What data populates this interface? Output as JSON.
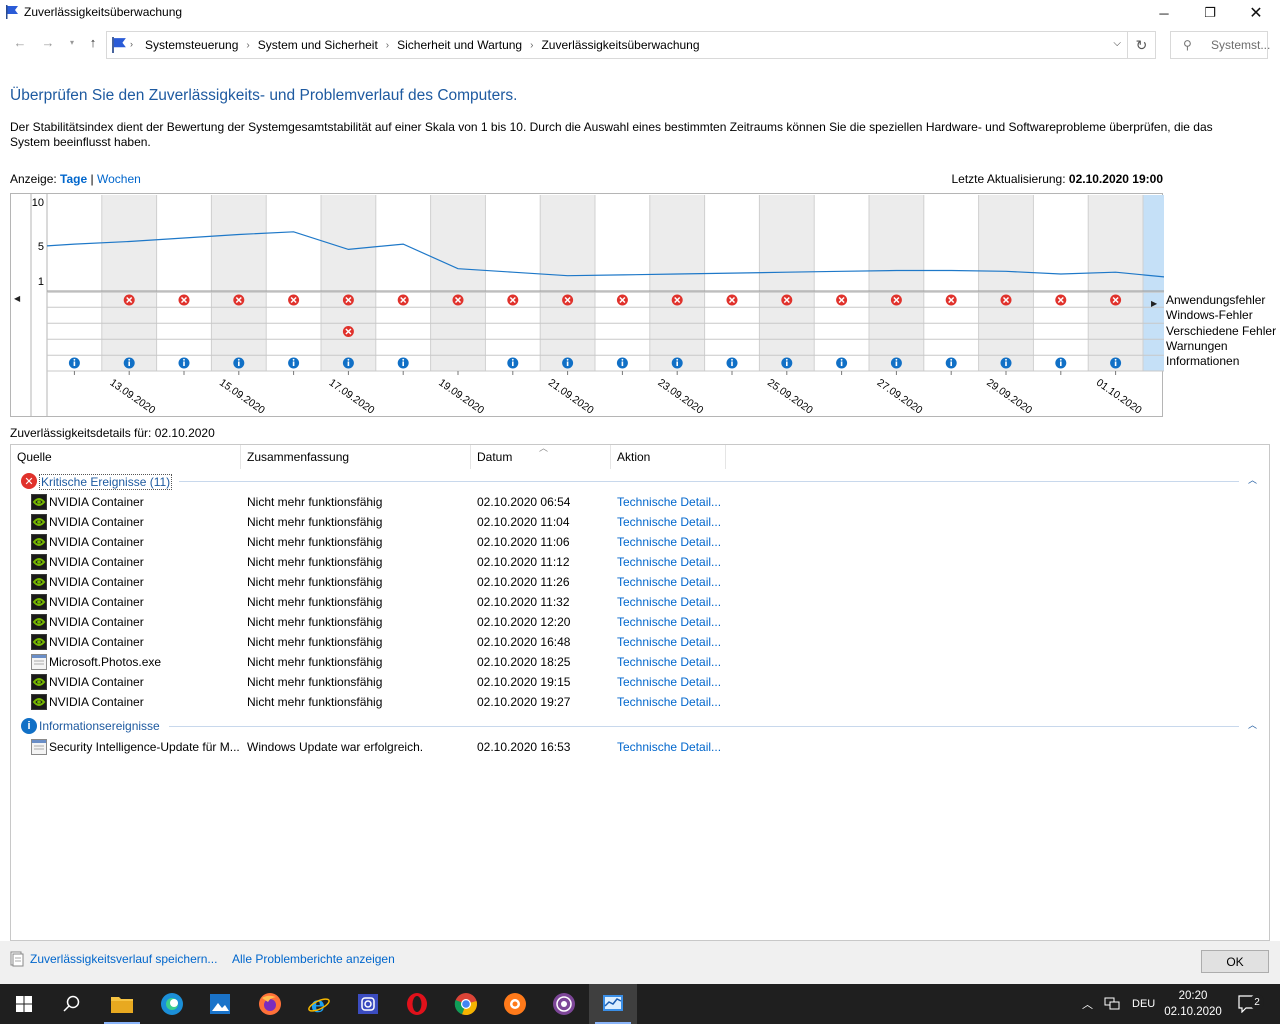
{
  "window": {
    "title": "Zuverlässigkeitsüberwachung"
  },
  "address": {
    "crumbs": [
      "Systemsteuerung",
      "System und Sicherheit",
      "Sicherheit und Wartung",
      "Zuverlässigkeitsüberwachung"
    ],
    "search_placeholder": "Systemst..."
  },
  "heading": "Überprüfen Sie den Zuverlässigkeits- und Problemverlauf des Computers.",
  "description": "Der Stabilitätsindex dient der Bewertung der Systemgesamtstabilität auf einer Skala von 1 bis 10. Durch die Auswahl eines bestimmten Zeitraums können Sie die speziellen Hardware- und Softwareprobleme überprüfen, die das System beeinflusst haben.",
  "view": {
    "label": "Anzeige:",
    "days": "Tage",
    "sep": "|",
    "weeks": "Wochen"
  },
  "last_update": {
    "label": "Letzte Aktualisierung:",
    "value": "02.10.2020 19:00"
  },
  "chart_data": {
    "type": "line",
    "ylim": [
      1,
      10
    ],
    "yticks": [
      "10",
      "5",
      "1"
    ],
    "x": [
      "12.09.2020",
      "13.09.2020",
      "14.09.2020",
      "15.09.2020",
      "16.09.2020",
      "17.09.2020",
      "18.09.2020",
      "19.09.2020",
      "20.09.2020",
      "21.09.2020",
      "22.09.2020",
      "23.09.2020",
      "24.09.2020",
      "25.09.2020",
      "26.09.2020",
      "27.09.2020",
      "28.09.2020",
      "29.09.2020",
      "30.09.2020",
      "01.10.2020",
      "02.10.2020"
    ],
    "xtick_labels": [
      "13.09.2020",
      "15.09.2020",
      "17.09.2020",
      "19.09.2020",
      "21.09.2020",
      "23.09.2020",
      "25.09.2020",
      "27.09.2020",
      "29.09.2020",
      "01.10.2020"
    ],
    "stability_index": [
      5.2,
      5.5,
      5.9,
      6.3,
      6.6,
      4.6,
      5.2,
      2.4,
      2.0,
      1.6,
      1.7,
      1.8,
      1.9,
      2.0,
      2.1,
      2.2,
      2.2,
      2.1,
      1.8,
      2.0,
      1.4
    ],
    "selected_day": "02.10.2020",
    "event_rows": [
      "Anwendungsfehler",
      "Windows-Fehler",
      "Verschiedene Fehler",
      "Warnungen",
      "Informationen"
    ],
    "anwendungsfehler_days": [
      1,
      2,
      3,
      4,
      5,
      6,
      7,
      8,
      9,
      10,
      11,
      12,
      13,
      14,
      15,
      16,
      17,
      18,
      19,
      20
    ],
    "verschiedene_fehler_days": [
      5
    ],
    "informationen_days": [
      0,
      1,
      2,
      3,
      4,
      5,
      6,
      8,
      9,
      10,
      11,
      12,
      13,
      14,
      15,
      16,
      17,
      18,
      19,
      20
    ]
  },
  "details_label": "Zuverlässigkeitsdetails für: 02.10.2020",
  "columns": [
    "Quelle",
    "Zusammenfassung",
    "Datum",
    "Aktion"
  ],
  "groups": [
    {
      "label": "Kritische Ereignisse (11)",
      "rows": [
        {
          "source": "NVIDIA Container",
          "summary": "Nicht mehr funktionsfähig",
          "date": "02.10.2020 06:54",
          "action": "Technische Detail...",
          "icon": "nvidia-icon"
        },
        {
          "source": "NVIDIA Container",
          "summary": "Nicht mehr funktionsfähig",
          "date": "02.10.2020 11:04",
          "action": "Technische Detail...",
          "icon": "nvidia-icon"
        },
        {
          "source": "NVIDIA Container",
          "summary": "Nicht mehr funktionsfähig",
          "date": "02.10.2020 11:06",
          "action": "Technische Detail...",
          "icon": "nvidia-icon"
        },
        {
          "source": "NVIDIA Container",
          "summary": "Nicht mehr funktionsfähig",
          "date": "02.10.2020 11:12",
          "action": "Technische Detail...",
          "icon": "nvidia-icon"
        },
        {
          "source": "NVIDIA Container",
          "summary": "Nicht mehr funktionsfähig",
          "date": "02.10.2020 11:26",
          "action": "Technische Detail...",
          "icon": "nvidia-icon"
        },
        {
          "source": "NVIDIA Container",
          "summary": "Nicht mehr funktionsfähig",
          "date": "02.10.2020 11:32",
          "action": "Technische Detail...",
          "icon": "nvidia-icon"
        },
        {
          "source": "NVIDIA Container",
          "summary": "Nicht mehr funktionsfähig",
          "date": "02.10.2020 12:20",
          "action": "Technische Detail...",
          "icon": "nvidia-icon"
        },
        {
          "source": "NVIDIA Container",
          "summary": "Nicht mehr funktionsfähig",
          "date": "02.10.2020 16:48",
          "action": "Technische Detail...",
          "icon": "nvidia-icon"
        },
        {
          "source": "Microsoft.Photos.exe",
          "summary": "Nicht mehr funktionsfähig",
          "date": "02.10.2020 18:25",
          "action": "Technische Detail...",
          "icon": "app-icon"
        },
        {
          "source": "NVIDIA Container",
          "summary": "Nicht mehr funktionsfähig",
          "date": "02.10.2020 19:15",
          "action": "Technische Detail...",
          "icon": "nvidia-icon"
        },
        {
          "source": "NVIDIA Container",
          "summary": "Nicht mehr funktionsfähig",
          "date": "02.10.2020 19:27",
          "action": "Technische Detail...",
          "icon": "nvidia-icon"
        }
      ]
    },
    {
      "label": "Informationsereignisse",
      "rows": [
        {
          "source": "Security Intelligence-Update für M...",
          "summary": "Windows Update war erfolgreich.",
          "date": "02.10.2020 16:53",
          "action": "Technische Detail...",
          "icon": "app-icon"
        }
      ]
    }
  ],
  "footer": {
    "save_link": "Zuverlässigkeitsverlauf speichern...",
    "all_reports_link": "Alle Problemberichte anzeigen",
    "ok": "OK"
  },
  "taskbar": {
    "lang": "DEU",
    "time": "20:20",
    "date": "02.10.2020",
    "notifications": "2",
    "apps": [
      "start-icon",
      "search-icon",
      "file-explorer-icon",
      "edge-icon",
      "photos-icon",
      "firefox-icon",
      "ie-icon",
      "instagram-icon",
      "opera-icon",
      "chrome-icon",
      "app-orange-icon",
      "tor-icon",
      "reliability-monitor-icon"
    ]
  },
  "colors": {
    "link": "#0066cc",
    "heading": "#1e5aa0",
    "chart_line": "#1e78c8",
    "selected": "#c5e0f7",
    "error": "#e0322c",
    "info": "#1170c6"
  }
}
